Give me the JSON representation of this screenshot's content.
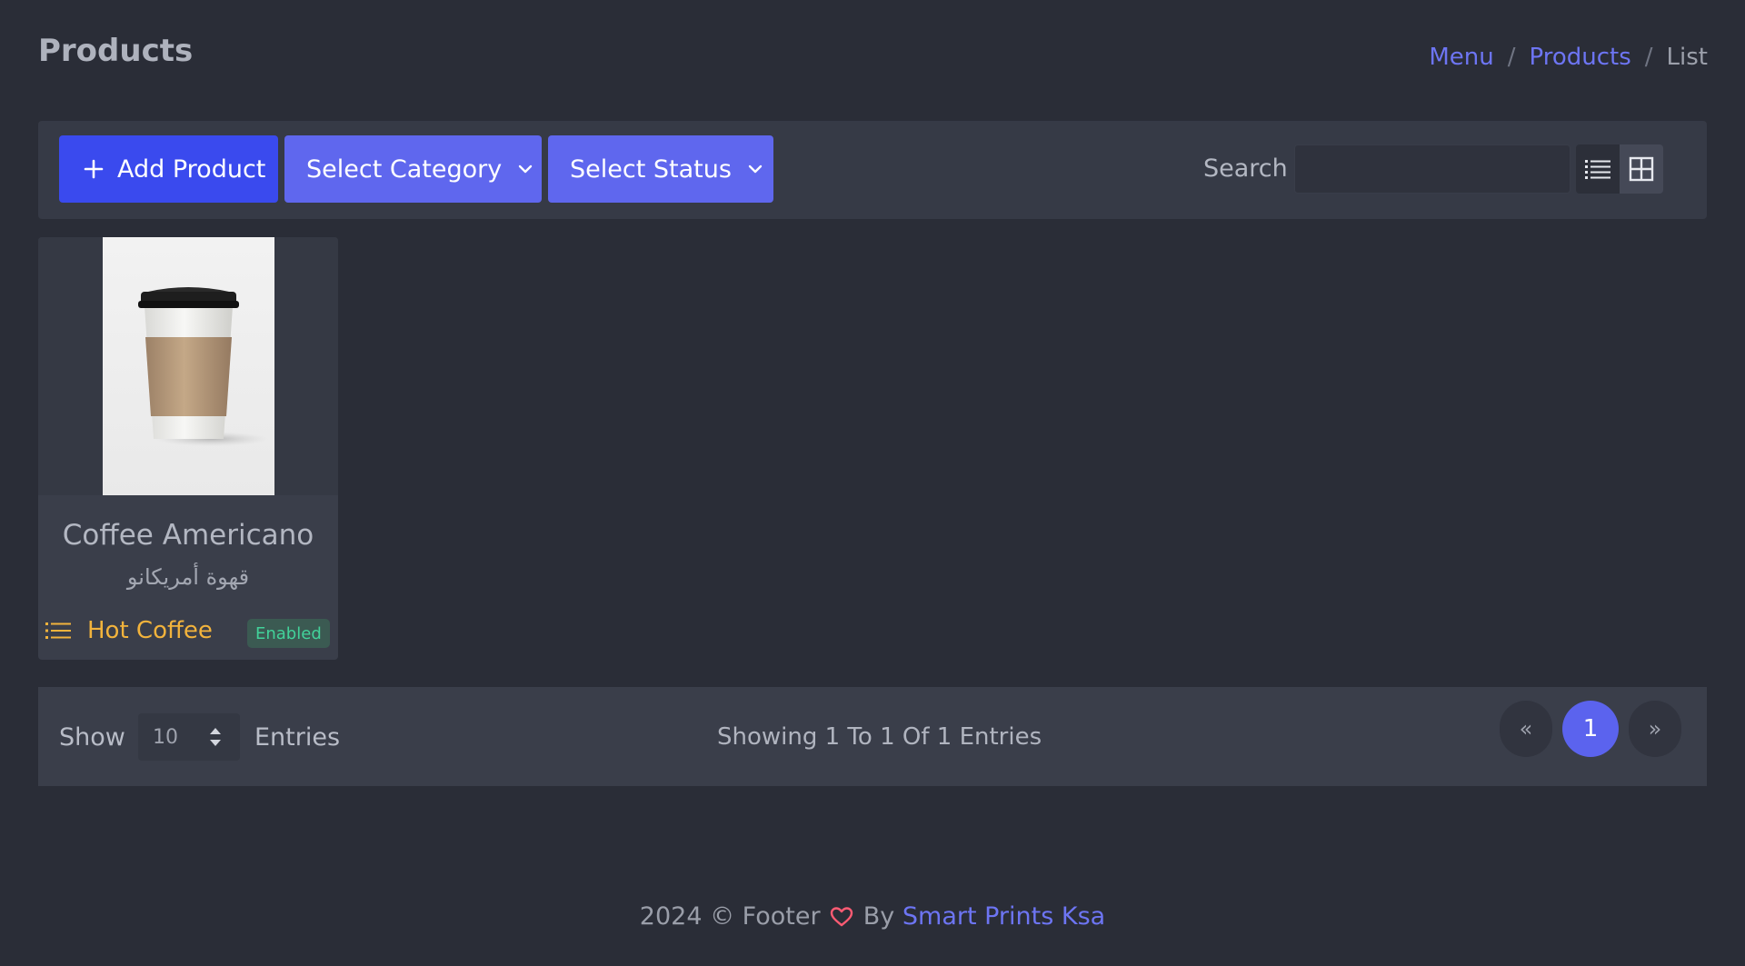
{
  "page": {
    "title": "Products"
  },
  "breadcrumb": {
    "items": [
      "Menu",
      "Products",
      "List"
    ],
    "separator": "/"
  },
  "toolbar": {
    "add_label": "Add Product",
    "category_label": "Select Category",
    "status_label": "Select Status",
    "search_label": "Search",
    "search_value": "",
    "icons": {
      "add": "plus-icon",
      "dropdown": "chevron-down-icon",
      "list_view": "list-view-icon",
      "grid_view": "grid-view-icon"
    },
    "active_view": "grid"
  },
  "products": [
    {
      "name": "Coffee Americano",
      "name_ar": "قهوة أمريكانو",
      "category": "Hot Coffee",
      "status": "Enabled",
      "image": "coffee-cup-photo"
    }
  ],
  "pagination": {
    "show_label": "Show",
    "entries_value": "10",
    "entries_label": "Entries",
    "summary": "Showing 1 To 1 Of 1 Entries",
    "prev": "«",
    "current": "1",
    "next": "»"
  },
  "footer": {
    "prefix": "2024 © Footer",
    "by": "By",
    "link": "Smart Prints Ksa"
  },
  "colors": {
    "background": "#2a2d37",
    "panel": "#363a46",
    "primary": "#3a4aee",
    "accent": "#5f67ee",
    "link": "#6d75f3",
    "category": "#f2b33c",
    "enabled": "#42d29a",
    "heart": "#ff5b73"
  }
}
